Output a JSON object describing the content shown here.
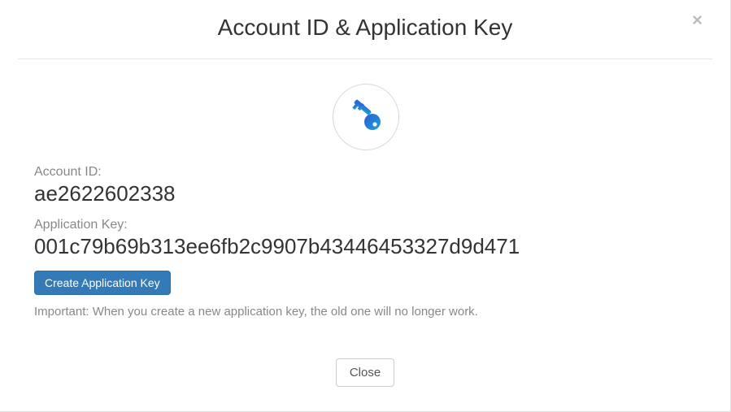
{
  "modal": {
    "title": "Account ID & Application Key",
    "close_x": "×",
    "icon_name": "key-icon",
    "account_id_label": "Account ID:",
    "account_id_value": "ae2622602338",
    "application_key_label": "Application Key:",
    "application_key_value": "001c79b69b313ee6fb2c9907b43446453327d9d471",
    "create_button_label": "Create Application Key",
    "important_note": "Important: When you create a new application key, the old one will no longer work.",
    "close_button_label": "Close"
  }
}
